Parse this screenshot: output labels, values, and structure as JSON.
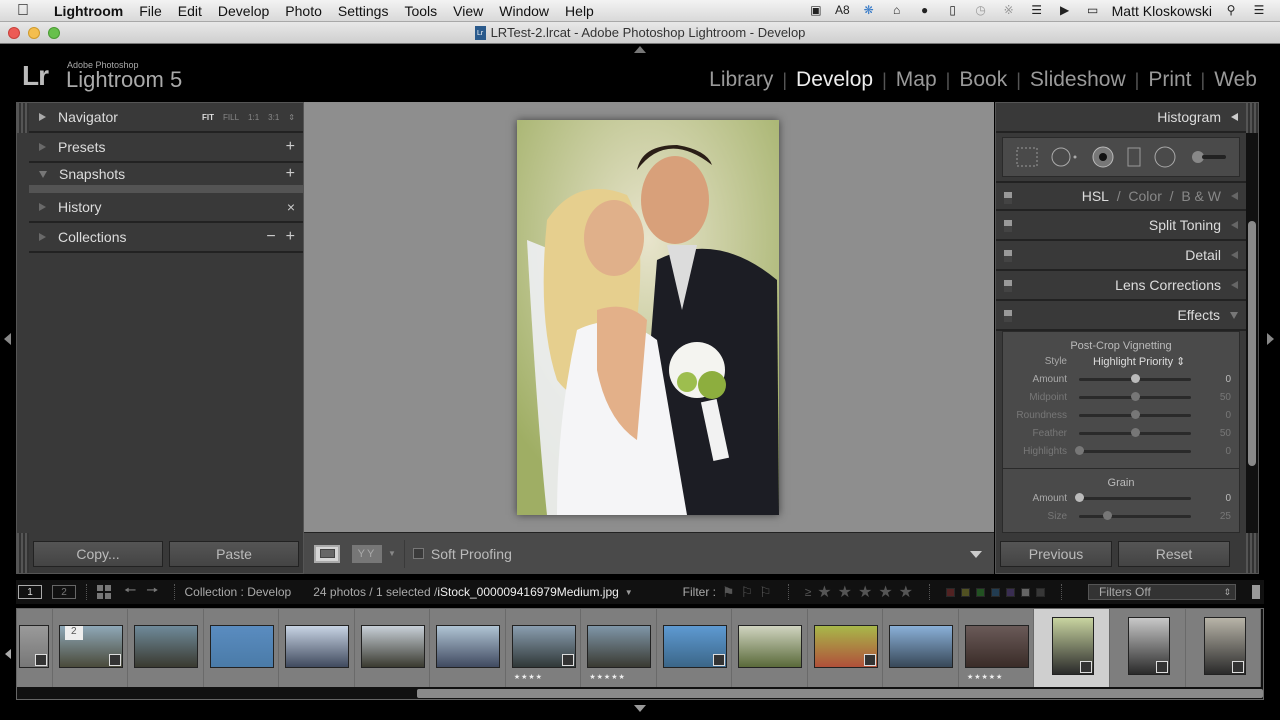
{
  "menubar": {
    "app": "Lightroom",
    "items": [
      "File",
      "Edit",
      "Develop",
      "Photo",
      "Settings",
      "Tools",
      "View",
      "Window",
      "Help"
    ],
    "tray": [
      "camera-icon",
      "adobe-icon",
      "dropbox-icon",
      "home-icon",
      "evernote-icon",
      "airplay-icon",
      "time-machine-icon",
      "bluetooth-icon",
      "wifi-icon",
      "volume-icon",
      "battery-icon"
    ],
    "adobe_badge": "8",
    "user": "Matt Kloskowski"
  },
  "window": {
    "title": "LRTest-2.lrcat - Adobe Photoshop Lightroom - Develop"
  },
  "identity": {
    "lr": "Lr",
    "adobe": "Adobe Photoshop",
    "product": "Lightroom 5"
  },
  "modules": [
    {
      "label": "Library",
      "active": false
    },
    {
      "label": "Develop",
      "active": true
    },
    {
      "label": "Map",
      "active": false
    },
    {
      "label": "Book",
      "active": false
    },
    {
      "label": "Slideshow",
      "active": false
    },
    {
      "label": "Print",
      "active": false
    },
    {
      "label": "Web",
      "active": false
    }
  ],
  "left_panel": {
    "navigator": {
      "label": "Navigator",
      "zoom_options": [
        "FIT",
        "FILL",
        "1:1",
        "3:1"
      ],
      "active_zoom": "FIT"
    },
    "presets": {
      "label": "Presets",
      "action": "+"
    },
    "snapshots": {
      "label": "Snapshots",
      "action": "+"
    },
    "history": {
      "label": "History",
      "action": "×"
    },
    "collections": {
      "label": "Collections",
      "action_minus": "−",
      "action_plus": "+"
    },
    "copy_button": "Copy...",
    "paste_button": "Paste"
  },
  "toolbar": {
    "soft_proofing_label": "Soft Proofing",
    "soft_proofing_checked": false,
    "yy_label": "YY"
  },
  "right_panel": {
    "histogram": "Histogram",
    "hsl": {
      "hsl": "HSL",
      "sep": "/",
      "color": "Color",
      "bw": "B & W"
    },
    "split_toning": "Split Toning",
    "detail": "Detail",
    "lens_corrections": "Lens Corrections",
    "effects": "Effects",
    "vignetting": {
      "title": "Post-Crop Vignetting",
      "style_label": "Style",
      "style_value": "Highlight Priority",
      "sliders": [
        {
          "label": "Amount",
          "value": "0",
          "position": 0.5,
          "enabled": true
        },
        {
          "label": "Midpoint",
          "value": "50",
          "position": 0.5,
          "enabled": false
        },
        {
          "label": "Roundness",
          "value": "0",
          "position": 0.5,
          "enabled": false
        },
        {
          "label": "Feather",
          "value": "50",
          "position": 0.5,
          "enabled": false
        },
        {
          "label": "Highlights",
          "value": "0",
          "position": 0.0,
          "enabled": false
        }
      ]
    },
    "grain": {
      "title": "Grain",
      "sliders": [
        {
          "label": "Amount",
          "value": "0",
          "position": 0.0,
          "enabled": true
        },
        {
          "label": "Size",
          "value": "25",
          "position": 0.25,
          "enabled": false
        }
      ]
    },
    "previous_button": "Previous",
    "reset_button": "Reset"
  },
  "filterbar": {
    "view1": "1",
    "view2": "2",
    "source": "Collection : Develop",
    "count": "24 photos / 1 selected /",
    "filename": "iStock_000009416979Medium.jpg",
    "filter_label": "Filter :",
    "gte": "≥",
    "color_labels": [
      "#a03838",
      "#a0a038",
      "#38a038",
      "#3870a0",
      "#6a50a0",
      "#cccccc",
      "#666666"
    ],
    "filter_select": "Filters Off"
  },
  "filmstrip": [
    {
      "colors": [
        "#9a9a9a",
        "#777777"
      ],
      "stars": "",
      "badge": true,
      "partial": true
    },
    {
      "colors": [
        "#8fa8b8",
        "#4a4a3a"
      ],
      "stars": "",
      "badge": true,
      "number": "2"
    },
    {
      "colors": [
        "#6f8a9a",
        "#3a3a30"
      ],
      "stars": ""
    },
    {
      "colors": [
        "#5a8cc0",
        "#4a7ba8"
      ],
      "stars": ""
    },
    {
      "colors": [
        "#c8d4e4",
        "#404a5e"
      ],
      "stars": ""
    },
    {
      "colors": [
        "#c8d0d8",
        "#3a3a30"
      ],
      "stars": ""
    },
    {
      "colors": [
        "#b0c4d4",
        "#404a60"
      ],
      "stars": ""
    },
    {
      "colors": [
        "#8a9eb0",
        "#303838"
      ],
      "stars": "★★★★",
      "badge": true
    },
    {
      "colors": [
        "#7f96a8",
        "#3a3a32"
      ],
      "stars": "★★★★★"
    },
    {
      "colors": [
        "#5e9ad2",
        "#3b6688"
      ],
      "stars": "",
      "badge": true
    },
    {
      "colors": [
        "#d0d4c0",
        "#5a6a3a"
      ],
      "stars": ""
    },
    {
      "colors": [
        "#a8b84a",
        "#b0503a"
      ],
      "stars": "",
      "badge": true
    },
    {
      "colors": [
        "#8ab0d8",
        "#384858"
      ],
      "stars": ""
    },
    {
      "colors": [
        "#6a5a58",
        "#3a2c28"
      ],
      "stars": "★★★★★"
    },
    {
      "colors": [
        "#c8d4a0",
        "#2a2a2a"
      ],
      "stars": "",
      "portrait": true,
      "selected": true,
      "badge": true
    },
    {
      "colors": [
        "#c8c8c8",
        "#2a2a2a"
      ],
      "stars": "",
      "portrait": true,
      "badge": true
    },
    {
      "colors": [
        "#b8b4a8",
        "#2a2a2a"
      ],
      "stars": "",
      "portrait": true,
      "badge": true
    }
  ]
}
